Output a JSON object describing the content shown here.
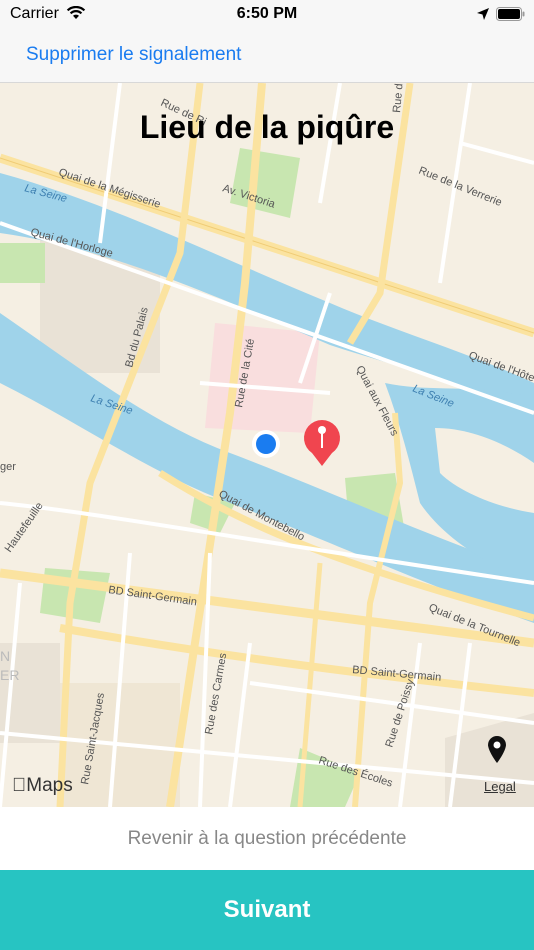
{
  "status_bar": {
    "carrier": "Carrier",
    "time": "6:50 PM"
  },
  "nav": {
    "delete_report_label": "Supprimer le signalement"
  },
  "map": {
    "title": "Lieu de la piqûre",
    "maps_logo": "Maps",
    "legal_label": "Legal",
    "street_labels": {
      "rue_de_ri": "Rue de Ri",
      "rue_de_ren": "Rue de Ren",
      "rue_de_la_verrerie": "Rue de la Verrerie",
      "quai_megisserie": "Quai de la Mégisserie",
      "av_victoria": "Av. Victoria",
      "la_seine_1": "La Seine",
      "quai_horloge": "Quai de l'Horloge",
      "bd_du_palais": "Bd du Palais",
      "rue_de_la_cite": "Rue de la Cité",
      "quai_aux_fleurs": "Quai aux Fleurs",
      "quai_de_l_hote": "Quai de l'Hôte",
      "la_seine_2": "La Seine",
      "la_seine_3": "La Seine",
      "quai_montebello": "Quai de Montebello",
      "hautefeuille": "Hautefeuille",
      "ger": "ger",
      "bd_saint_germain_1": "BD Saint-Germain",
      "bd_saint_germain_2": "BD Saint-Germain",
      "quai_tournelle": "Quai de la Tournelle",
      "rue_des_carmes": "Rue des Carmes",
      "rue_saint_jacques": "Rue Saint-Jacques",
      "rue_de_poissy": "Rue de Poissy",
      "rue_des_ecoles": "Rue des Écoles",
      "n_letter": "N",
      "er_letters": "ER"
    }
  },
  "footer": {
    "back_label": "Revenir à la question précédente",
    "next_label": "Suivant"
  },
  "colors": {
    "accent": "#27c4c2",
    "link": "#1a7cf0",
    "pin": "#f0454f",
    "user_location": "#1a7cf0",
    "water": "#9fd3ea",
    "land": "#f5efe3",
    "road_major": "#fbe3a0"
  },
  "icons": {
    "wifi": "wifi-icon",
    "location_arrow": "location-arrow-icon",
    "battery": "battery-icon",
    "pin": "map-pin-icon",
    "user_location": "user-location-icon",
    "tracking": "location-marker-icon",
    "apple": "apple-logo-icon"
  }
}
